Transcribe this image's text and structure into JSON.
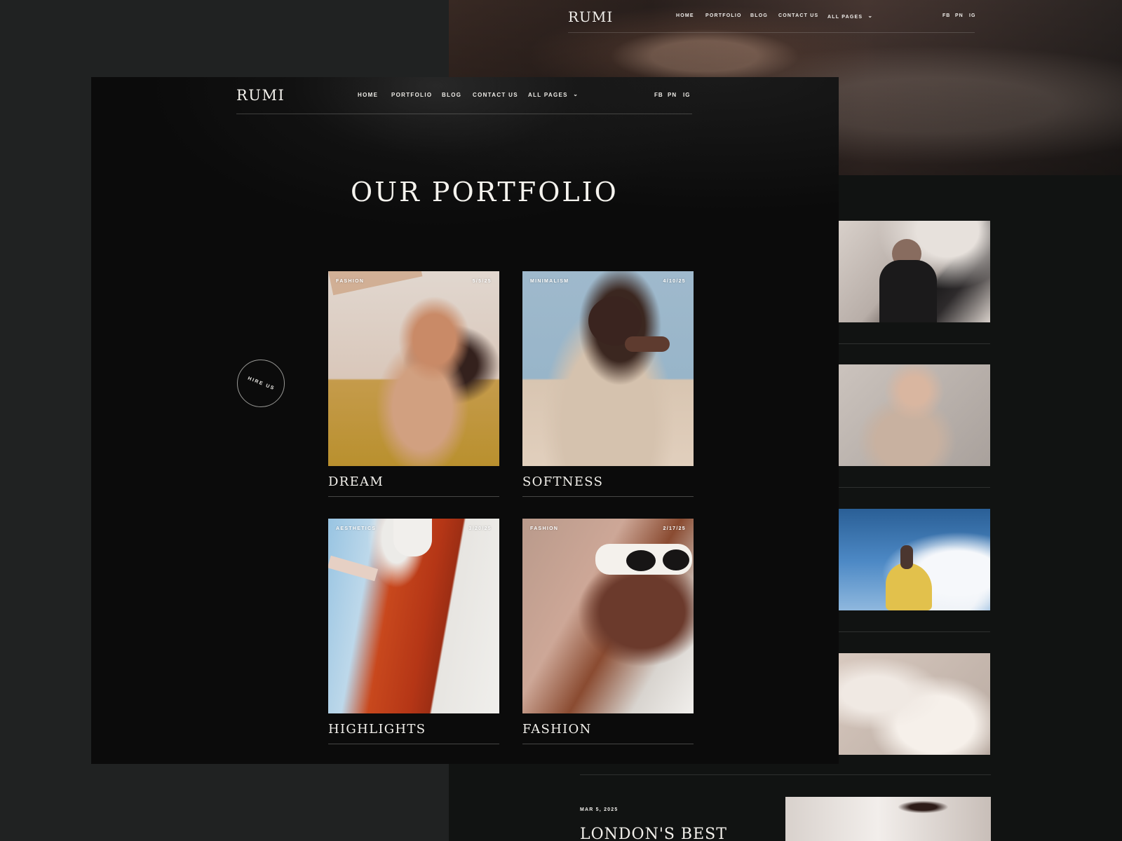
{
  "background_page": {
    "logo": "RUMI",
    "nav": [
      "HOME",
      "PORTFOLIO",
      "BLOG",
      "CONTACT US",
      "ALL PAGES"
    ],
    "social": [
      "FB",
      "PN",
      "IG"
    ],
    "post": {
      "date": "MAR 5, 2025",
      "headline": "LONDON'S BEST"
    }
  },
  "foreground_page": {
    "logo": "RUMI",
    "nav": {
      "home": "HOME",
      "portfolio": "PORTFOLIO",
      "blog": "BLOG",
      "contact": "CONTACT US",
      "all_pages": "ALL PAGES"
    },
    "social": {
      "fb": "FB",
      "pn": "PN",
      "ig": "IG"
    },
    "title": "OUR PORTFOLIO",
    "hire_us": "HIRE US",
    "cards": [
      {
        "category": "FASHION",
        "date": "5/5/25",
        "title": "DREAM"
      },
      {
        "category": "MINIMALISM",
        "date": "4/10/25",
        "title": "SOFTNESS"
      },
      {
        "category": "AESTHETICS",
        "date": "3/20/25",
        "title": "HIGHLIGHTS"
      },
      {
        "category": "FASHION",
        "date": "2/17/25",
        "title": "FASHION"
      }
    ]
  },
  "icons": {
    "dropdown": "chevron-down-icon"
  }
}
